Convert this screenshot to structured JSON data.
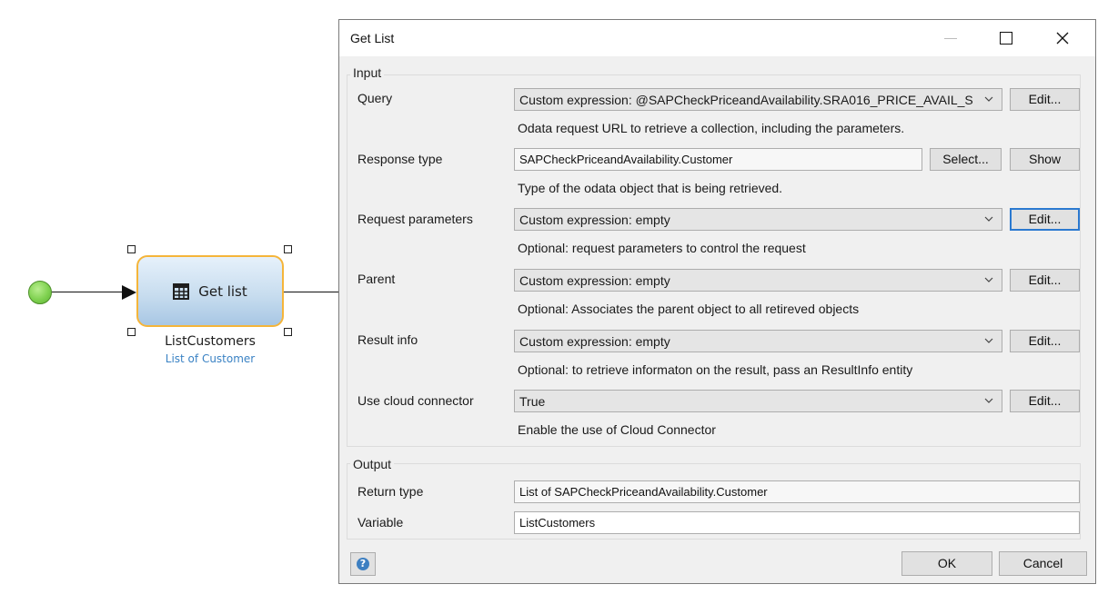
{
  "canvas": {
    "activity": {
      "label": "Get list",
      "icon": "table-icon",
      "name": "ListCustomers",
      "type": "List of Customer",
      "colors": {
        "border": "#f5b53a",
        "fill": "#c8ddef",
        "start": "#7fd150"
      }
    }
  },
  "dialog": {
    "title": "Get List",
    "close_glyph": "✕",
    "input_group": "Input",
    "output_group": "Output",
    "rows": {
      "query": {
        "label": "Query",
        "value": "Custom expression: @SAPCheckPriceandAvailability.SRA016_PRICE_AVAIL_S",
        "hint": "Odata request URL to retrieve a collection, including the parameters.",
        "button": "Edit..."
      },
      "response_type": {
        "label": "Response type",
        "value": "SAPCheckPriceandAvailability.Customer",
        "hint": "Type of the odata object that is being retrieved.",
        "select_button": "Select...",
        "show_button": "Show"
      },
      "request_parameters": {
        "label": "Request parameters",
        "value": "Custom expression: empty",
        "hint": "Optional: request parameters to control the request",
        "button": "Edit..."
      },
      "parent": {
        "label": "Parent",
        "value": "Custom expression: empty",
        "hint": "Optional:  Associates the parent object to all retireved objects",
        "button": "Edit..."
      },
      "result_info": {
        "label": "Result info",
        "value": "Custom expression: empty",
        "hint": "Optional: to retrieve informaton on the result, pass an ResultInfo entity",
        "button": "Edit..."
      },
      "use_cloud_connector": {
        "label": "Use cloud connector",
        "value": "True",
        "hint": "Enable the use of Cloud Connector",
        "button": "Edit..."
      }
    },
    "output": {
      "return_type_label": "Return type",
      "return_type_value": "List of SAPCheckPriceandAvailability.Customer",
      "variable_label": "Variable",
      "variable_value": "ListCustomers"
    },
    "footer": {
      "help_glyph": "?",
      "ok": "OK",
      "cancel": "Cancel"
    },
    "colors": {
      "background": "#f0f0f0",
      "focus": "#2b79d0",
      "help": "#3d7fc1"
    }
  }
}
